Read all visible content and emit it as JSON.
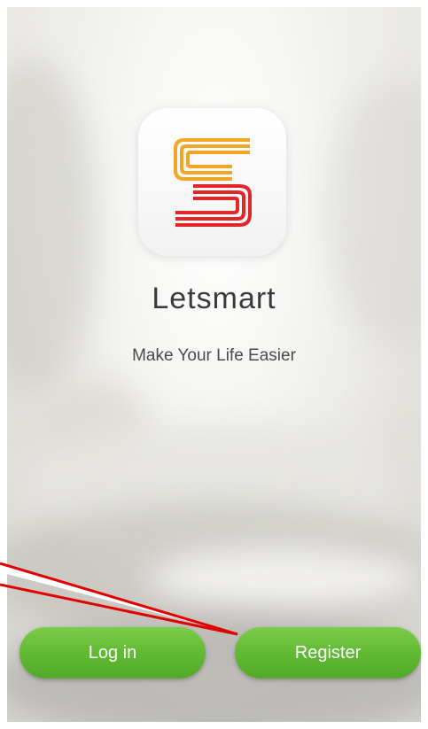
{
  "app": {
    "name": "Letsmart",
    "tagline": "Make Your Life Easier"
  },
  "buttons": {
    "login_label": "Log in",
    "register_label": "Register"
  },
  "colors": {
    "button_green": "#5fb832",
    "logo_orange": "#f2a623",
    "logo_red": "#e0282a",
    "annotation_red": "#e00000"
  },
  "icons": {
    "app_logo": "letsmart-s-logo-icon"
  }
}
